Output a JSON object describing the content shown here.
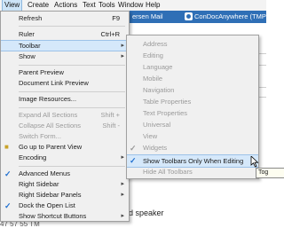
{
  "menubar": {
    "items": [
      "View",
      "Create",
      "Actions",
      "Text",
      "Tools",
      "Window",
      "Help"
    ]
  },
  "background": {
    "strip_text": "ersen Mail",
    "strip_text2": "ConDocAnywhere (TMP",
    "doc_text": "nd speaker",
    "doc_text2": "47 57 55 TM"
  },
  "view_menu": {
    "items": [
      {
        "label": "Refresh",
        "shortcut": "F9"
      },
      {
        "label": "Ruler",
        "shortcut": "Ctrl+R"
      },
      {
        "label": "Toolbar"
      },
      {
        "label": "Show"
      },
      {
        "label": "Parent Preview"
      },
      {
        "label": "Document Link Preview"
      },
      {
        "label": "Image Resources..."
      },
      {
        "label": "Expand All Sections",
        "shortcut": "Shift +"
      },
      {
        "label": "Collapse All Sections",
        "shortcut": "Shift -"
      },
      {
        "label": "Switch Form..."
      },
      {
        "label": "Go up to Parent View"
      },
      {
        "label": "Encoding"
      },
      {
        "label": "Advanced Menus"
      },
      {
        "label": "Right Sidebar"
      },
      {
        "label": "Right Sidebar Panels"
      },
      {
        "label": "Dock the Open List"
      },
      {
        "label": "Show Shortcut Buttons"
      }
    ]
  },
  "toolbar_submenu": {
    "items": [
      {
        "label": "Address"
      },
      {
        "label": "Editing"
      },
      {
        "label": "Language"
      },
      {
        "label": "Mobile"
      },
      {
        "label": "Navigation"
      },
      {
        "label": "Table Properties"
      },
      {
        "label": "Text Properties"
      },
      {
        "label": "Universal"
      },
      {
        "label": "View"
      },
      {
        "label": "Widgets"
      },
      {
        "label": "Show Toolbars Only When Editing"
      },
      {
        "label": "Hide All Toolbars"
      }
    ]
  },
  "tooltip": "Tog",
  "icons": {
    "check": "checkmark-icon",
    "submenu": "chevron-right-icon",
    "pointer": "mouse-pointer-icon"
  }
}
